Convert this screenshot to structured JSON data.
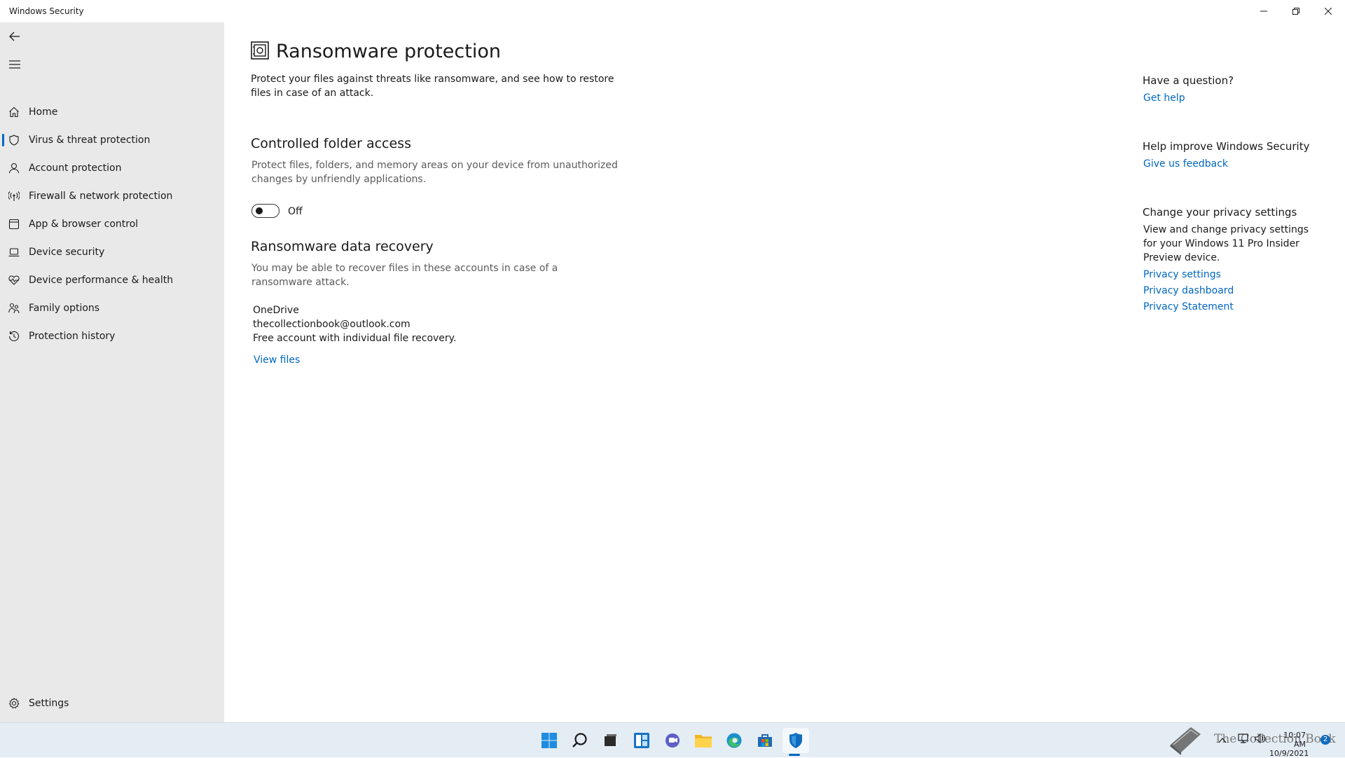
{
  "window": {
    "title": "Windows Security"
  },
  "sidebar": {
    "items": [
      {
        "label": "Home",
        "icon": "home-icon"
      },
      {
        "label": "Virus & threat protection",
        "icon": "shield-icon",
        "active": true
      },
      {
        "label": "Account protection",
        "icon": "person-icon"
      },
      {
        "label": "Firewall & network protection",
        "icon": "antenna-icon"
      },
      {
        "label": "App & browser control",
        "icon": "app-window-icon"
      },
      {
        "label": "Device security",
        "icon": "laptop-icon"
      },
      {
        "label": "Device performance & health",
        "icon": "heart-pulse-icon"
      },
      {
        "label": "Family options",
        "icon": "family-icon"
      },
      {
        "label": "Protection history",
        "icon": "history-icon"
      }
    ],
    "settings_label": "Settings"
  },
  "main": {
    "title": "Ransomware protection",
    "description_line1": "Protect your files against threats like ransomware, and see how to restore",
    "description_line2": "files in case of an attack.",
    "cfa": {
      "heading": "Controlled folder access",
      "desc_line1": "Protect files, folders, and memory areas on your device from unauthorized",
      "desc_line2": "changes by unfriendly applications.",
      "toggle_label": "Off",
      "toggle_on": false
    },
    "recovery": {
      "heading": "Ransomware data recovery",
      "desc_line1": "You may be able to recover files in these accounts in case of a",
      "desc_line2": "ransomware attack.",
      "provider": "OneDrive",
      "account": "thecollectionbook@outlook.com",
      "plan": "Free account with individual file recovery.",
      "view_files": "View files"
    }
  },
  "right": {
    "question_heading": "Have a question?",
    "get_help": "Get help",
    "improve_heading": "Help improve Windows Security",
    "feedback": "Give us feedback",
    "privacy_heading": "Change your privacy settings",
    "privacy_desc_line1": "View and change privacy settings",
    "privacy_desc_line2": "for your Windows 11 Pro Insider",
    "privacy_desc_line3": "Preview device.",
    "privacy_settings": "Privacy settings",
    "privacy_dashboard": "Privacy dashboard",
    "privacy_statement": "Privacy Statement"
  },
  "taskbar": {
    "apps": [
      "start-icon",
      "search-icon",
      "task-view-icon",
      "widgets-icon",
      "chat-icon",
      "file-explorer-icon",
      "edge-icon",
      "store-icon",
      "windows-security-icon"
    ],
    "watermark": "The Collection Book",
    "time": "10:07 AM",
    "date": "10/9/2021",
    "notification_count": "2"
  },
  "colors": {
    "accent": "#0067c0",
    "sidebar_bg": "#e9e9e9",
    "taskbar_bg": "#e4ecf4"
  }
}
